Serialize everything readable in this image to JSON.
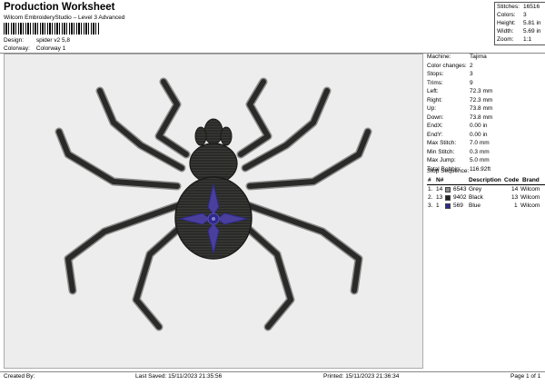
{
  "header": {
    "title": "Production Worksheet",
    "subtitle": "Wilcom EmbroideryStudio – Level 3 Advanced"
  },
  "design_info": {
    "design_label": "Design:",
    "design_value": "spider v2 5,8",
    "colorway_label": "Colorway:",
    "colorway_value": "Colorway 1"
  },
  "stats": [
    {
      "label": "Stitches:",
      "value": "16516"
    },
    {
      "label": "Colors:",
      "value": "3"
    },
    {
      "label": "Height:",
      "value": "5.81 in"
    },
    {
      "label": "Width:",
      "value": "5.69 in"
    },
    {
      "label": "Zoom:",
      "value": "1:1"
    }
  ],
  "machine_info": [
    {
      "label": "Machine:",
      "value": "Tajima"
    },
    {
      "label": "Color changes:",
      "value": "2"
    },
    {
      "label": "Stops:",
      "value": "3"
    },
    {
      "label": "Trims:",
      "value": "9"
    },
    {
      "label": "Left:",
      "value": "72.3 mm"
    },
    {
      "label": "Right:",
      "value": "72.3 mm"
    },
    {
      "label": "Up:",
      "value": "73.8 mm"
    },
    {
      "label": "Down:",
      "value": "73.8 mm"
    },
    {
      "label": "EndX:",
      "value": "0.00 in"
    },
    {
      "label": "EndY:",
      "value": "0.00 in"
    },
    {
      "label": "Max Stitch:",
      "value": "7.0 mm"
    },
    {
      "label": "Min Stitch:",
      "value": "0.3 mm"
    },
    {
      "label": "Max Jump:",
      "value": "5.0 mm"
    },
    {
      "label": "Total Bobbin:",
      "value": "116.92ft"
    }
  ],
  "stop_sequence": {
    "title": "Stop Sequence:",
    "columns": [
      "#",
      "N#",
      "Description",
      "Code",
      "Brand"
    ],
    "rows": [
      {
        "num": "1.",
        "n": "14",
        "swatch": "#8c8c8c",
        "code_num": "6543",
        "desc": "Grey",
        "code": "14",
        "brand": "Wilcom"
      },
      {
        "num": "2.",
        "n": "13",
        "swatch": "#222222",
        "code_num": "9402",
        "desc": "Black",
        "code": "13",
        "brand": "Wilcom"
      },
      {
        "num": "3.",
        "n": "1",
        "swatch": "#2e2a8c",
        "code_num": "569",
        "desc": "Blue",
        "code": "1",
        "brand": "Wilcom"
      }
    ]
  },
  "footer": {
    "created_by": "Created By:",
    "last_saved": "Last Saved: 15/11/2023 21:35:56",
    "printed": "Printed: 15/11/2023 21:36:34",
    "page": "Page 1 of 1"
  },
  "colors": {
    "thread_grey": "#8c8c8c",
    "thread_black": "#222222",
    "thread_blue": "#2e2a8c",
    "canvas_bg": "#ededed"
  }
}
